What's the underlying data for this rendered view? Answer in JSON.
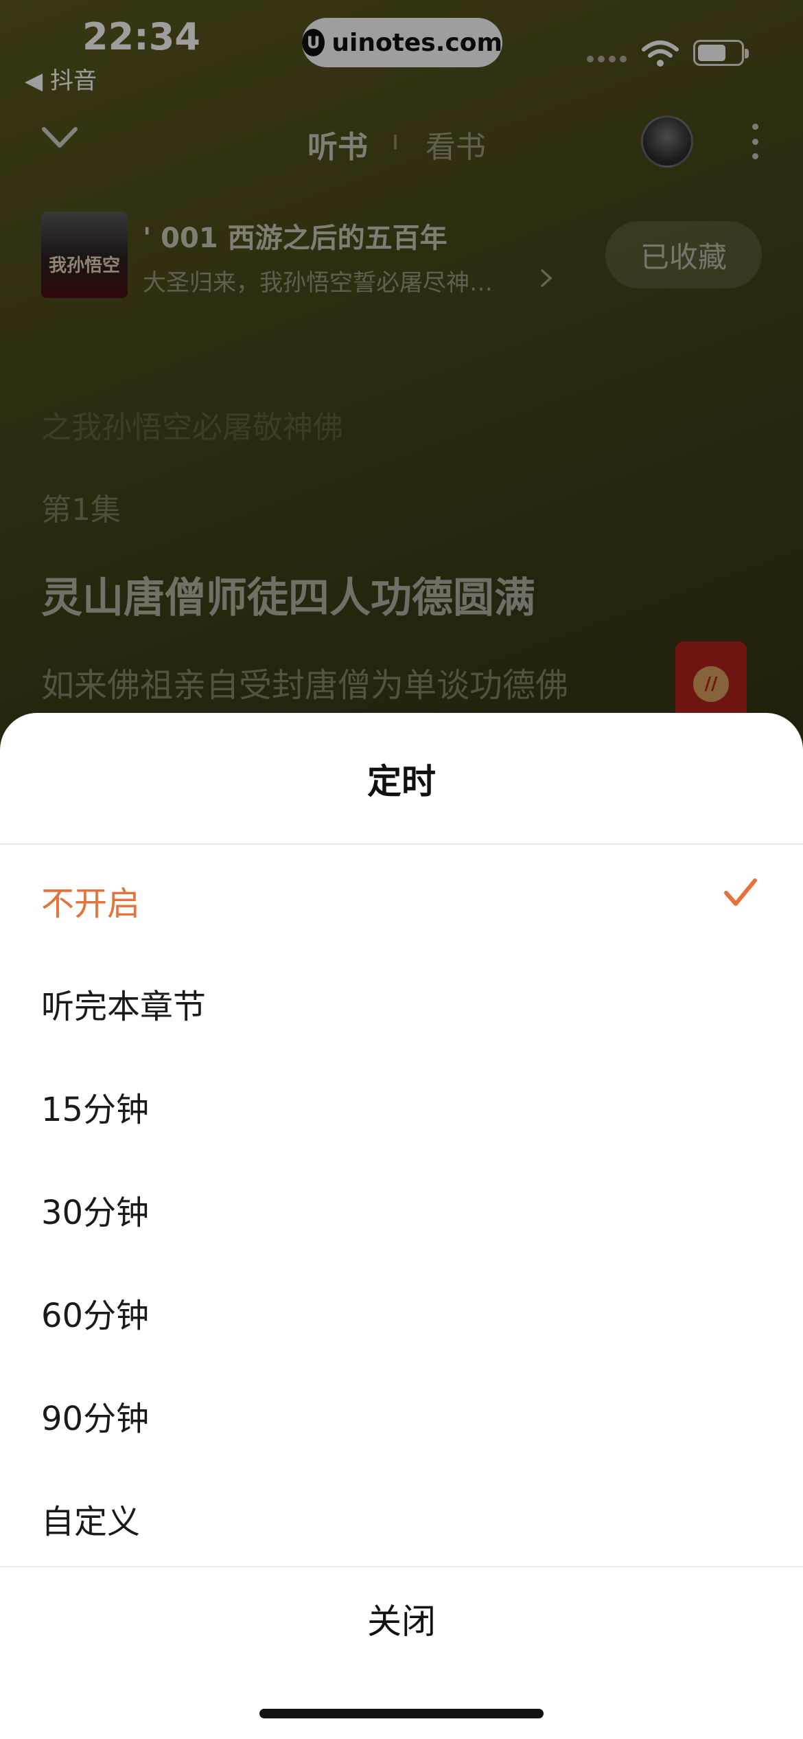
{
  "status_bar": {
    "time": "22:34",
    "back_app": "◀ 抖音",
    "url": "uinotes.com"
  },
  "header": {
    "tab_listen": "听书",
    "tab_read": "看书"
  },
  "book": {
    "title": "' 001 西游之后的五百年",
    "subtitle": "大圣归来，我孙悟空誓必屠尽神…",
    "cover_text": "我孙悟空",
    "favorite_label": "已收藏"
  },
  "content": {
    "faded_line": "之我孙悟空必屠敬神佛",
    "episode": "第1集",
    "chapter_title": "灵山唐僧师徒四人功德圆满",
    "chapter_line": "如来佛祖亲自受封唐僧为单谈功德佛"
  },
  "sheet": {
    "title": "定时",
    "options": [
      {
        "label": "不开启",
        "selected": true
      },
      {
        "label": "听完本章节",
        "selected": false
      },
      {
        "label": "15分钟",
        "selected": false
      },
      {
        "label": "30分钟",
        "selected": false
      },
      {
        "label": "60分钟",
        "selected": false
      },
      {
        "label": "90分钟",
        "selected": false
      },
      {
        "label": "自定义",
        "selected": false
      }
    ],
    "close_label": "关闭"
  },
  "colors": {
    "accent": "#e8703a",
    "sheet_bg": "#ffffff"
  }
}
